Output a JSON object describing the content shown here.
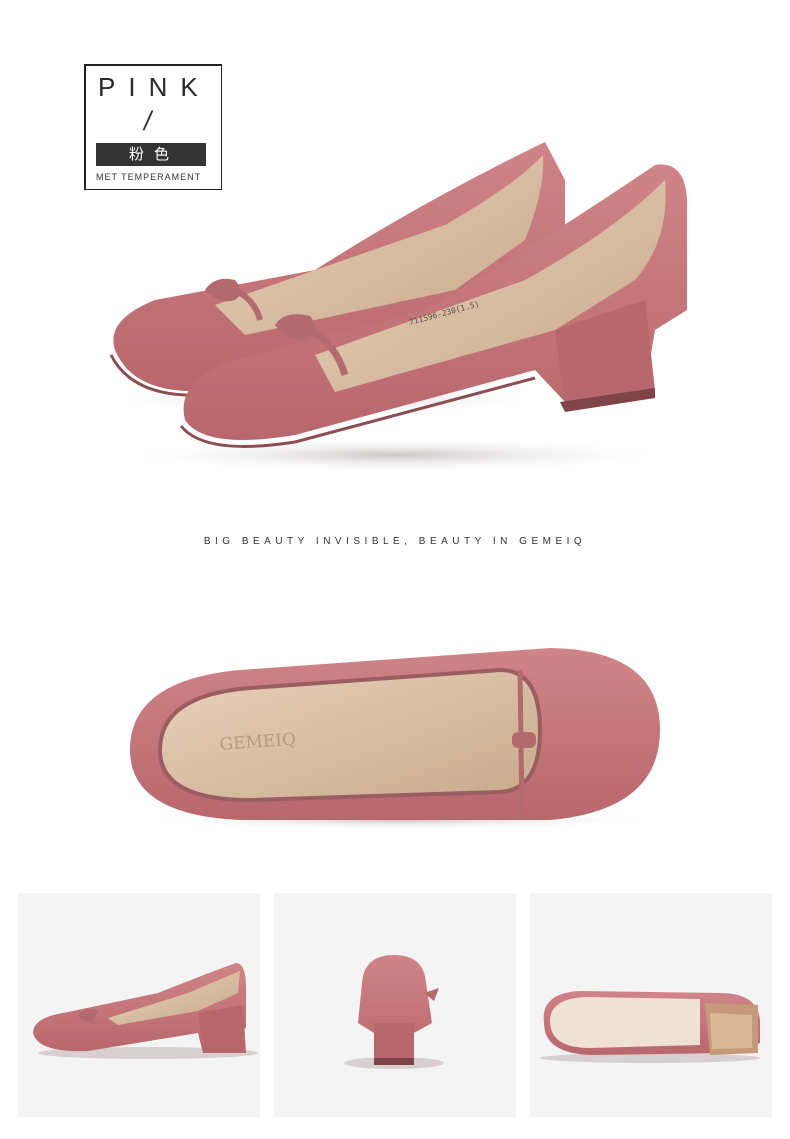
{
  "label": {
    "title": "PINK",
    "slash": "/",
    "chinese": "粉色",
    "subtitle": "MET TEMPERAMENT"
  },
  "tagline": "BIG BEAUTY INVISIBLE, BEAUTY IN GEMEIQ",
  "insole_brand": "GEMEIQ",
  "size_stamp": "711596-230(1.5)",
  "colors": {
    "suede": "#c67a7e",
    "suede_dark": "#a35a5f",
    "lining": "#dcc2a8",
    "thumb_bg": "#f4f4f4"
  },
  "images": [
    "pair-of-pink-suede-block-heel-pumps",
    "top-view-shoe-interior",
    "side-view-shoe",
    "back-view-heel",
    "sole-view"
  ]
}
